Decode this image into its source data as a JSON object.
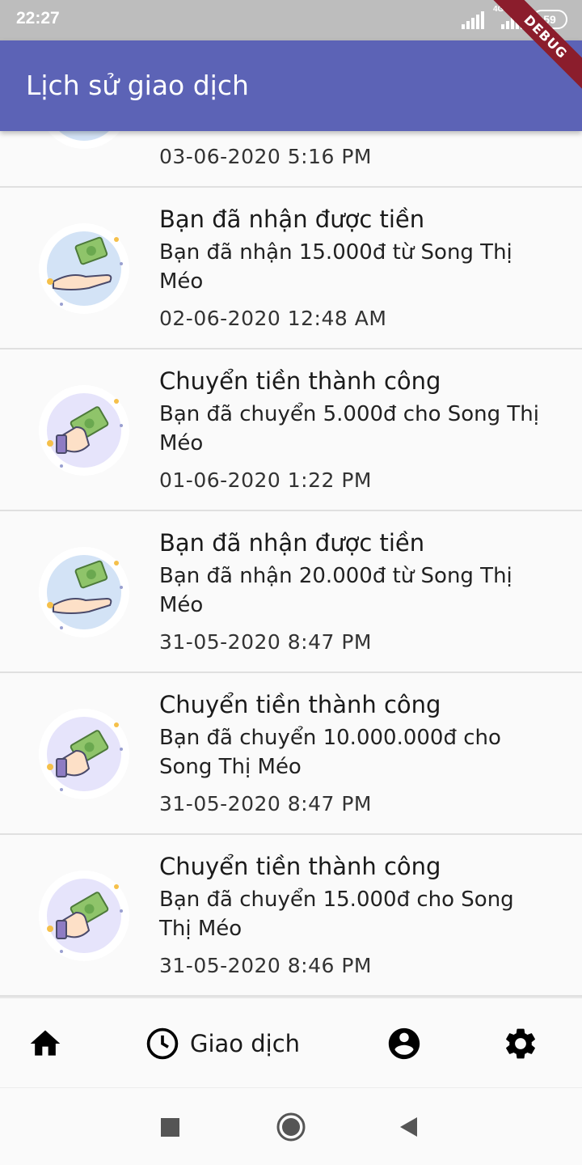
{
  "status_bar": {
    "time": "22:27",
    "network": "4G",
    "battery": "59",
    "debug_banner": "DEBUG"
  },
  "app_bar": {
    "title": "Lịch sử giao dịch",
    "color": "#5c63b6"
  },
  "transactions": [
    {
      "type": "received",
      "icon": "money-receive-icon",
      "title": "",
      "description": "",
      "time": "03-06-2020 5:16 PM"
    },
    {
      "type": "received",
      "icon": "money-receive-icon",
      "title": "Bạn đã nhận được tiền",
      "description": "Bạn đã nhận 15.000đ từ Song Thị Méo",
      "time": "02-06-2020 12:48 AM"
    },
    {
      "type": "sent",
      "icon": "money-send-icon",
      "title": "Chuyển tiền thành công",
      "description": "Bạn đã chuyển 5.000đ cho Song Thị Méo",
      "time": "01-06-2020 1:22 PM"
    },
    {
      "type": "received",
      "icon": "money-receive-icon",
      "title": "Bạn đã nhận được tiền",
      "description": "Bạn đã nhận 20.000đ từ Song Thị Méo",
      "time": "31-05-2020 8:47 PM"
    },
    {
      "type": "sent",
      "icon": "money-send-icon",
      "title": "Chuyển tiền thành công",
      "description": "Bạn đã chuyển 10.000.000đ cho Song Thị Méo",
      "time": "31-05-2020 8:47 PM"
    },
    {
      "type": "sent",
      "icon": "money-send-icon",
      "title": "Chuyển tiền thành công",
      "description": "Bạn đã chuyển 15.000đ cho Song Thị Méo",
      "time": "31-05-2020 8:46 PM"
    }
  ],
  "bottom_nav": {
    "items": [
      {
        "icon": "home-icon",
        "label": ""
      },
      {
        "icon": "history-clock-icon",
        "label": "Giao dịch",
        "selected": true
      },
      {
        "icon": "account-circle-icon",
        "label": ""
      },
      {
        "icon": "settings-gear-icon",
        "label": ""
      }
    ]
  },
  "system_nav": {
    "buttons": [
      "recents-square-icon",
      "home-circle-icon",
      "back-triangle-icon"
    ]
  }
}
